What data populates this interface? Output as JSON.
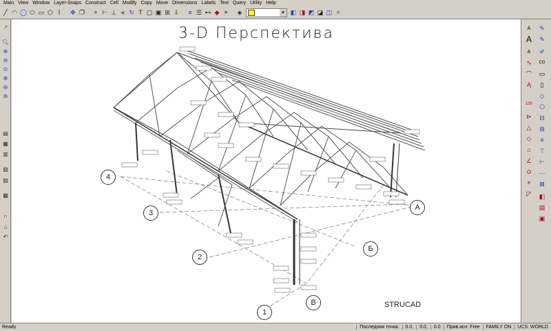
{
  "menu": [
    "Main",
    "View",
    "Window",
    "Layer-Snaps",
    "Construct",
    "Cell",
    "Modify",
    "Copy",
    "Move",
    "Dimensions",
    "Labels",
    "Text",
    "Query",
    "Utility",
    "Help"
  ],
  "color_select": {
    "value": ""
  },
  "drawing": {
    "title": "3-D Перспектива",
    "brand": "STRUCAD",
    "grid_bubbles": [
      {
        "label": "4"
      },
      {
        "label": "3"
      },
      {
        "label": "2"
      },
      {
        "label": "1"
      },
      {
        "label": "A"
      },
      {
        "label": "Б"
      },
      {
        "label": "B"
      }
    ]
  },
  "status": {
    "ready": "Ready",
    "last_point_label": "Последняя точка:",
    "x": "0.0,",
    "y": "0.0,",
    "z": "0.0",
    "snap": "Прив.ясн: Free",
    "family": "FAMILY ON",
    "ucs": "UCS: WORLD"
  }
}
